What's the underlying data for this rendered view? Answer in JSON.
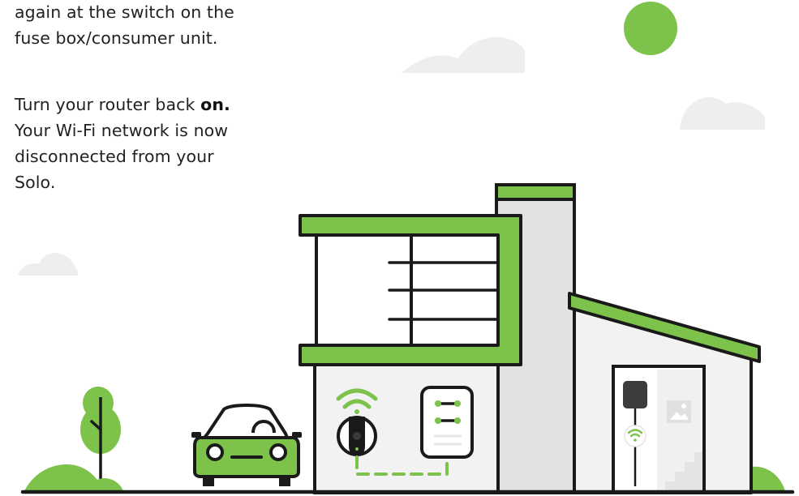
{
  "instructions": {
    "paragraph1": {
      "line1": "again at the switch on the",
      "line2": "fuse box/consumer unit."
    },
    "paragraph2": {
      "line1_prefix": "Turn your router back ",
      "line1_bold": "on.",
      "line2": "Your Wi-Fi network is now",
      "line3": "disconnected from your",
      "line4": "Solo."
    }
  },
  "colors": {
    "accent_green": "#7dc24b",
    "outline": "#1a1a1a",
    "wall_light": "#f2f2f2",
    "wall_mid": "#e2e2e2",
    "cloud": "#eeeeee"
  },
  "icons": [
    "sun-icon",
    "cloud-icon",
    "tree-icon",
    "bush-icon",
    "car-icon",
    "wifi-icon",
    "ev-charger-icon",
    "consumer-unit-icon",
    "image-frame-icon",
    "house-illustration"
  ]
}
